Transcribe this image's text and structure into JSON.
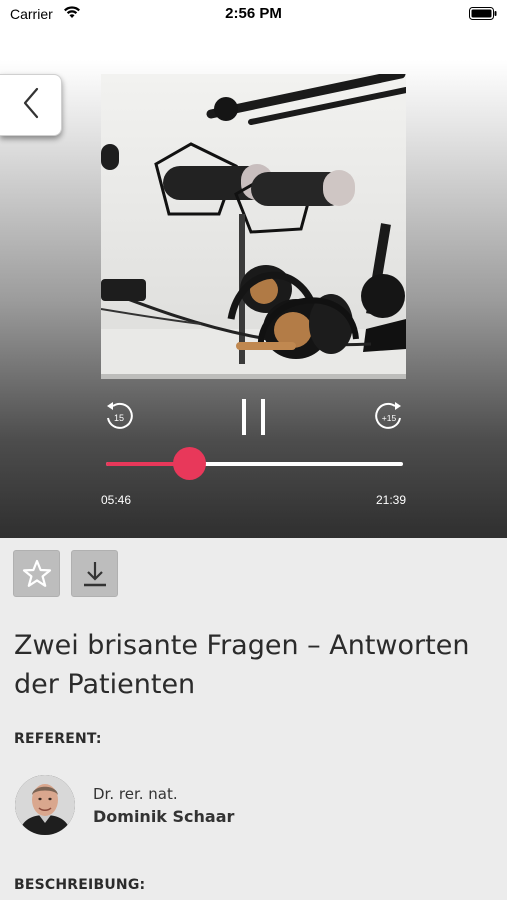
{
  "status_bar": {
    "carrier": "Carrier",
    "time": "2:56 PM"
  },
  "player": {
    "back_icon": "chevron-left-icon",
    "artwork_subject": "podcast microphones and headphones",
    "skip_back_label": "15",
    "skip_forward_label": "+15",
    "pause_icon": "pause-icon",
    "elapsed": "05:46",
    "duration": "21:39",
    "progress_fraction": 0.28,
    "accent_color": "#e8385a"
  },
  "actions": {
    "favorite_icon": "star-icon",
    "download_icon": "download-icon"
  },
  "episode": {
    "title": "Zwei brisante Fragen – Antworten der Patienten"
  },
  "speaker": {
    "label": "REFERENT:",
    "title": "Dr. rer. nat.",
    "name": "Dominik Schaar"
  },
  "description": {
    "label": "BESCHREIBUNG:"
  }
}
